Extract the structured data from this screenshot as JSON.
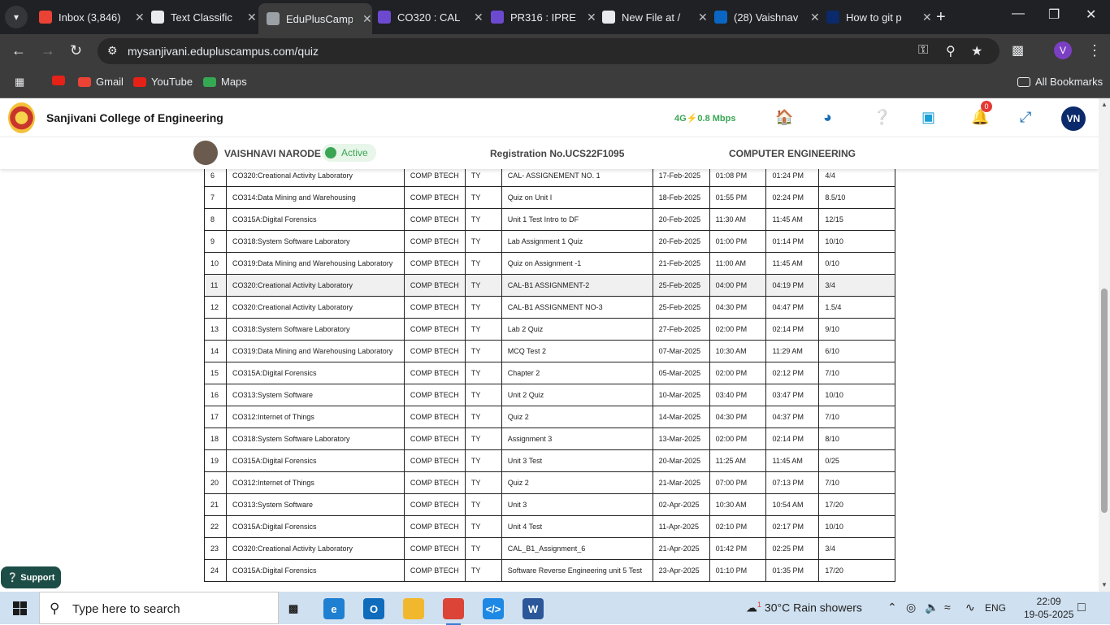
{
  "browser": {
    "tabs": [
      {
        "title": "Inbox (3,846)",
        "icon": "gmail-icon",
        "color": "#ea4335",
        "active": false
      },
      {
        "title": "Text Classific",
        "icon": "openai-icon",
        "color": "#e8eaed",
        "active": false
      },
      {
        "title": "EduPlusCamp",
        "icon": "globe-icon",
        "color": "#9aa0a6",
        "active": true
      },
      {
        "title": "CO320 : CAL",
        "icon": "form-icon",
        "color": "#6c4ad0",
        "active": false
      },
      {
        "title": "PR316 : IPRE",
        "icon": "form-icon",
        "color": "#6c4ad0",
        "active": false
      },
      {
        "title": "New File at /",
        "icon": "github-icon",
        "color": "#e8eaed",
        "active": false
      },
      {
        "title": "(28) Vaishnav",
        "icon": "linkedin-icon",
        "color": "#0a66c2",
        "active": false
      },
      {
        "title": "How to git p",
        "icon": "tab-icon",
        "color": "#0b2a6b",
        "active": false
      }
    ],
    "url": "mysanjivani.edupluscampus.com/quiz",
    "profile_letter": "V",
    "bookmarks": [
      {
        "label": "",
        "icon": "youtube-icon"
      },
      {
        "label": "Gmail",
        "icon": "gmail-icon"
      },
      {
        "label": "YouTube",
        "icon": "youtube-icon"
      },
      {
        "label": "Maps",
        "icon": "maps-icon"
      }
    ],
    "all_bookmarks": "All Bookmarks"
  },
  "app": {
    "college": "Sanjivani College of Engineering",
    "network": "4G",
    "speed": "0.8 Mbps",
    "notifications": "0",
    "user_initials": "VN",
    "student_name": "VAISHNAVI NARODE",
    "status": "Active",
    "registration": "Registration No.UCS22F1095",
    "department": "COMPUTER ENGINEERING",
    "support": "Support"
  },
  "quiz_rows": [
    {
      "no": "6",
      "subject": "CO320:Creational Activity Laboratory",
      "program": "COMP BTECH",
      "year": "TY",
      "title": "CAL- ASSIGNEMENT NO. 1",
      "date": "17-Feb-2025",
      "start": "01:08 PM",
      "end": "01:24 PM",
      "score": "4/4"
    },
    {
      "no": "7",
      "subject": "CO314:Data Mining and Warehousing",
      "program": "COMP BTECH",
      "year": "TY",
      "title": "Quiz on Unit I",
      "date": "18-Feb-2025",
      "start": "01:55 PM",
      "end": "02:24 PM",
      "score": "8.5/10"
    },
    {
      "no": "8",
      "subject": "CO315A:Digital Forensics",
      "program": "COMP BTECH",
      "year": "TY",
      "title": "Unit 1 Test Intro to DF",
      "date": "20-Feb-2025",
      "start": "11:30 AM",
      "end": "11:45 AM",
      "score": "12/15"
    },
    {
      "no": "9",
      "subject": "CO318:System Software Laboratory",
      "program": "COMP BTECH",
      "year": "TY",
      "title": "Lab Assignment 1 Quiz",
      "date": "20-Feb-2025",
      "start": "01:00 PM",
      "end": "01:14 PM",
      "score": "10/10"
    },
    {
      "no": "10",
      "subject": "CO319:Data Mining and Warehousing Laboratory",
      "program": "COMP BTECH",
      "year": "TY",
      "title": "Quiz on Assignment -1",
      "date": "21-Feb-2025",
      "start": "11:00 AM",
      "end": "11:45 AM",
      "score": "0/10"
    },
    {
      "no": "11",
      "subject": "CO320:Creational Activity Laboratory",
      "program": "COMP BTECH",
      "year": "TY",
      "title": "CAL-B1 ASSIGNMENT-2",
      "date": "25-Feb-2025",
      "start": "04:00 PM",
      "end": "04:19 PM",
      "score": "3/4"
    },
    {
      "no": "12",
      "subject": "CO320:Creational Activity Laboratory",
      "program": "COMP BTECH",
      "year": "TY",
      "title": "CAL-B1 ASSIGNMENT NO-3",
      "date": "25-Feb-2025",
      "start": "04:30 PM",
      "end": "04:47 PM",
      "score": "1.5/4"
    },
    {
      "no": "13",
      "subject": "CO318:System Software Laboratory",
      "program": "COMP BTECH",
      "year": "TY",
      "title": "Lab 2 Quiz",
      "date": "27-Feb-2025",
      "start": "02:00 PM",
      "end": "02:14 PM",
      "score": "9/10"
    },
    {
      "no": "14",
      "subject": "CO319:Data Mining and Warehousing Laboratory",
      "program": "COMP BTECH",
      "year": "TY",
      "title": "MCQ Test 2",
      "date": "07-Mar-2025",
      "start": "10:30 AM",
      "end": "11:29 AM",
      "score": "6/10"
    },
    {
      "no": "15",
      "subject": "CO315A:Digital Forensics",
      "program": "COMP BTECH",
      "year": "TY",
      "title": "Chapter 2",
      "date": "05-Mar-2025",
      "start": "02:00 PM",
      "end": "02:12 PM",
      "score": "7/10"
    },
    {
      "no": "16",
      "subject": "CO313:System Software",
      "program": "COMP BTECH",
      "year": "TY",
      "title": "Unit 2 Quiz",
      "date": "10-Mar-2025",
      "start": "03:40 PM",
      "end": "03:47 PM",
      "score": "10/10"
    },
    {
      "no": "17",
      "subject": "CO312:Internet of Things",
      "program": "COMP BTECH",
      "year": "TY",
      "title": "Quiz 2",
      "date": "14-Mar-2025",
      "start": "04:30 PM",
      "end": "04:37 PM",
      "score": "7/10"
    },
    {
      "no": "18",
      "subject": "CO318:System Software Laboratory",
      "program": "COMP BTECH",
      "year": "TY",
      "title": "Assignment 3",
      "date": "13-Mar-2025",
      "start": "02:00 PM",
      "end": "02:14 PM",
      "score": "8/10"
    },
    {
      "no": "19",
      "subject": "CO315A:Digital Forensics",
      "program": "COMP BTECH",
      "year": "TY",
      "title": "Unit 3 Test",
      "date": "20-Mar-2025",
      "start": "11:25 AM",
      "end": "11:45 AM",
      "score": "0/25"
    },
    {
      "no": "20",
      "subject": "CO312:Internet of Things",
      "program": "COMP BTECH",
      "year": "TY",
      "title": "Quiz 2",
      "date": "21-Mar-2025",
      "start": "07:00 PM",
      "end": "07:13 PM",
      "score": "7/10"
    },
    {
      "no": "21",
      "subject": "CO313:System Software",
      "program": "COMP BTECH",
      "year": "TY",
      "title": "Unit 3",
      "date": "02-Apr-2025",
      "start": "10:30 AM",
      "end": "10:54 AM",
      "score": "17/20"
    },
    {
      "no": "22",
      "subject": "CO315A:Digital Forensics",
      "program": "COMP BTECH",
      "year": "TY",
      "title": "Unit 4 Test",
      "date": "11-Apr-2025",
      "start": "02:10 PM",
      "end": "02:17 PM",
      "score": "10/10"
    },
    {
      "no": "23",
      "subject": "CO320:Creational Activity Laboratory",
      "program": "COMP BTECH",
      "year": "TY",
      "title": "CAL_B1_Assignment_6",
      "date": "21-Apr-2025",
      "start": "01:42 PM",
      "end": "02:25 PM",
      "score": "3/4"
    },
    {
      "no": "24",
      "subject": "CO315A:Digital Forensics",
      "program": "COMP BTECH",
      "year": "TY",
      "title": "Software Reverse Engineering unit 5 Test",
      "date": "23-Apr-2025",
      "start": "01:10 PM",
      "end": "01:35 PM",
      "score": "17/20"
    }
  ],
  "taskbar": {
    "search_placeholder": "Type here to search",
    "weather_badge": "1",
    "weather": "30°C  Rain showers",
    "language": "ENG",
    "time": "22:09",
    "date": "19-05-2025"
  }
}
